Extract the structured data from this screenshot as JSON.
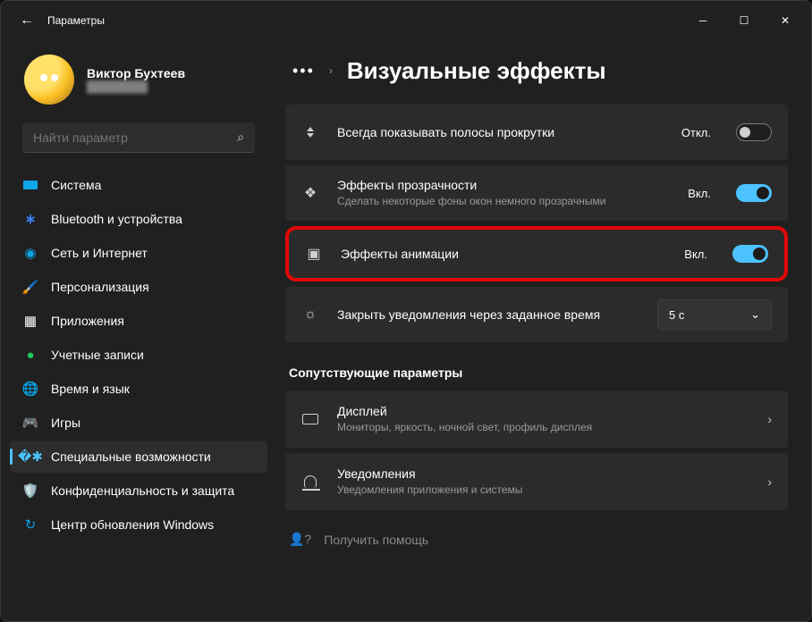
{
  "window": {
    "title": "Параметры"
  },
  "profile": {
    "name": "Виктор Бухтеев",
    "email": "████████"
  },
  "search": {
    "placeholder": "Найти параметр"
  },
  "nav": [
    {
      "label": "Система",
      "icon": "🖥️"
    },
    {
      "label": "Bluetooth и устройства",
      "icon": "bt"
    },
    {
      "label": "Сеть и Интернет",
      "icon": "wifi"
    },
    {
      "label": "Персонализация",
      "icon": "brush"
    },
    {
      "label": "Приложения",
      "icon": "apps"
    },
    {
      "label": "Учетные записи",
      "icon": "person"
    },
    {
      "label": "Время и язык",
      "icon": "globe"
    },
    {
      "label": "Игры",
      "icon": "game"
    },
    {
      "label": "Специальные возможности",
      "icon": "access"
    },
    {
      "label": "Конфиденциальность и защита",
      "icon": "shield"
    },
    {
      "label": "Центр обновления Windows",
      "icon": "update"
    }
  ],
  "nav_active": 8,
  "breadcrumb": {
    "title": "Визуальные эффекты"
  },
  "settings": {
    "scrollbars": {
      "title": "Всегда показывать полосы прокрутки",
      "state": "Откл.",
      "on": false
    },
    "transparency": {
      "title": "Эффекты прозрачности",
      "sub": "Сделать некоторые фоны окон немного прозрачными",
      "state": "Вкл.",
      "on": true
    },
    "animation": {
      "title": "Эффекты анимации",
      "state": "Вкл.",
      "on": true
    },
    "notif_close": {
      "title": "Закрыть уведомления через заданное время",
      "value": "5 с"
    }
  },
  "related": {
    "heading": "Сопутствующие параметры",
    "display": {
      "title": "Дисплей",
      "sub": "Мониторы, яркость, ночной свет, профиль дисплея"
    },
    "notifications": {
      "title": "Уведомления",
      "sub": "Уведомления приложения и системы"
    }
  },
  "help": {
    "label": "Получить помощь"
  }
}
